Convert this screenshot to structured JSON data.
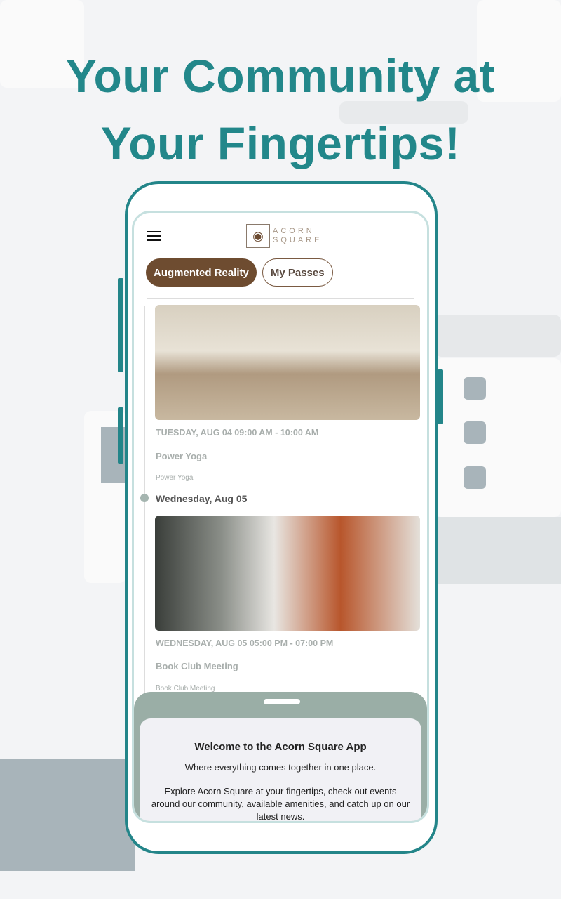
{
  "headline": {
    "line1": "Your Community at",
    "line2": "Your Fingertips!"
  },
  "colors": {
    "accent": "#22878a",
    "brown": "#6e4c30",
    "sheet": "#9aaea6"
  },
  "app": {
    "logo": {
      "icon": "acorn-icon",
      "text1": "ACORN",
      "text2": "SQUARE"
    },
    "tabs": [
      {
        "label": "Augmented Reality",
        "active": true
      },
      {
        "label": "My Passes",
        "active": false
      }
    ],
    "events": [
      {
        "time": "TUESDAY, AUG 04 09:00 AM - 10:00 AM",
        "title": "Power Yoga",
        "subtitle": "Power Yoga"
      },
      {
        "time": "WEDNESDAY, AUG 05 05:00 PM - 07:00 PM",
        "title": "Book Club Meeting",
        "subtitle": "Book Club Meeting"
      }
    ],
    "day_header": "Wednesday, Aug 05",
    "sheet": {
      "title": "Welcome to the Acorn Square App",
      "line1": "Where everything comes together in one place.",
      "line2": "Explore Acorn Square at your fingertips, check out events around our community, available amenities, and catch up on our latest news."
    }
  }
}
